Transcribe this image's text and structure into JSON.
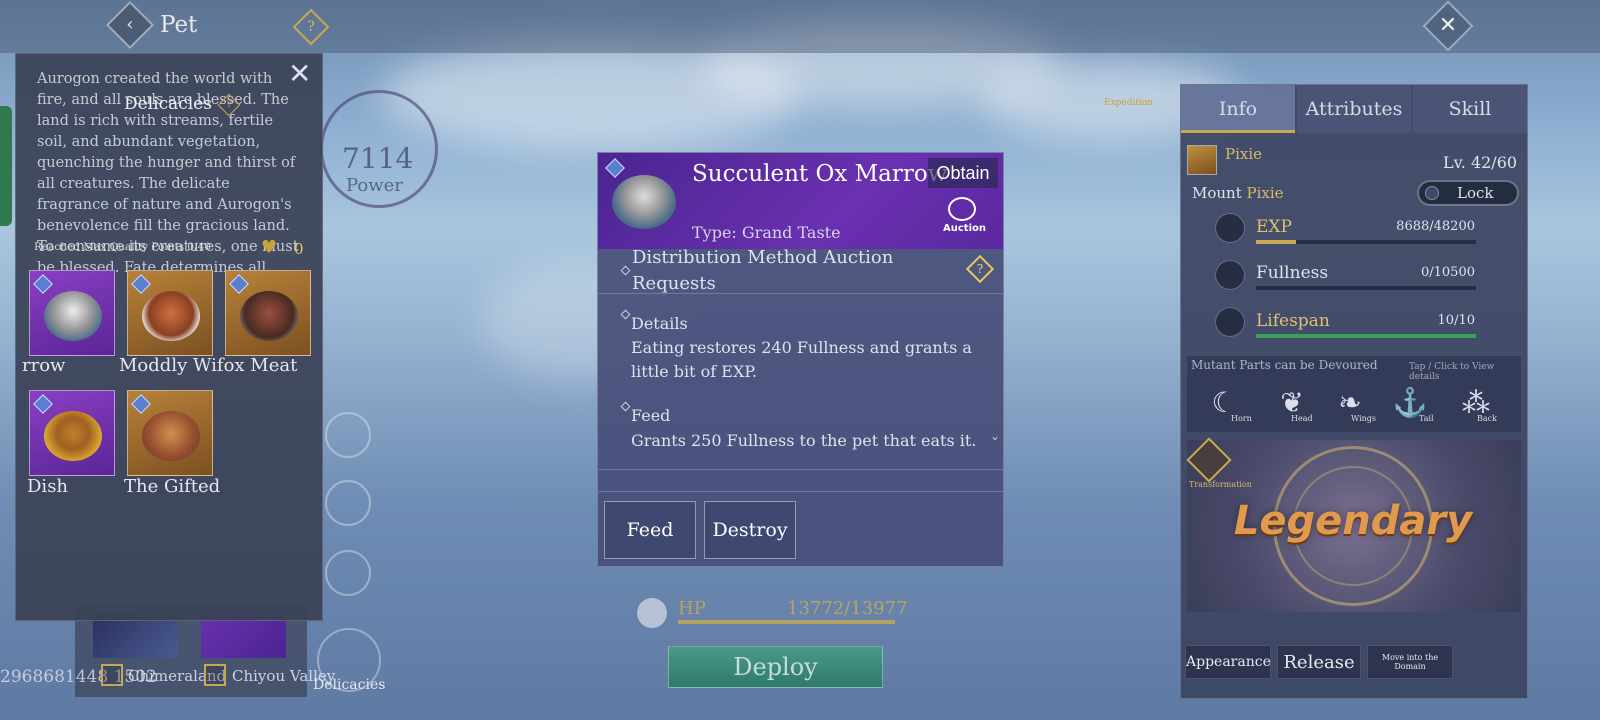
{
  "header": {
    "back_icon": "‹",
    "title": "Pet",
    "help_icon": "?",
    "close_icon": "✕"
  },
  "delicacies_panel": {
    "lore": "Aurogon created the world with fire, and all souls are blessed. The land is rich with streams, fertile soil, and abundant vegetation, quenching the hunger and thirst of all creatures. The delicate fragrance of nature and Aurogon's benevolence fill the gracious land. To consume its creatures, one must be blessed. Fate determines all.",
    "title": "Delicacies",
    "help_icon": "?",
    "close_icon": "✕",
    "quality_text": "Reached Max Quality Points 0/40",
    "heart_icon": "♥",
    "heart_count": "0",
    "items": [
      {
        "name": "rrow",
        "rarity": "purple"
      },
      {
        "name": "Moddly Wifox Meat",
        "rarity": "gold"
      },
      {
        "name": "",
        "rarity": "gold"
      },
      {
        "name": "Dish",
        "rarity": "purple"
      },
      {
        "name": "The Gifted",
        "rarity": "gold"
      }
    ]
  },
  "background": {
    "power_value": "7114",
    "power_label": "Power",
    "coords": "2968681448 1502",
    "locations": [
      "Chimeraland",
      "Chiyou Valley"
    ],
    "delicacies_label": "Delicacies",
    "expedition_label": "Expedition"
  },
  "item_popup": {
    "name": "Succulent Ox Marrow",
    "obtain_label": "Obtain",
    "type_text": "Type: Grand Taste",
    "auction_label": "Auction",
    "distribution_text": "Distribution Method    Auction Requests",
    "help_icon": "?",
    "details_head": "Details",
    "details_body": "Eating restores 240 Fullness and grants a little bit of EXP.",
    "feed_head": "Feed",
    "feed_body": "Grants 250 Fullness to the pet that eats it.",
    "scroll_icon": "⌄",
    "feed_button": "Feed",
    "destroy_button": "Destroy"
  },
  "status": {
    "hp_label": "HP",
    "hp_value": "13772/13977",
    "hp_fraction": 0.985,
    "deploy_button": "Deploy"
  },
  "info_panel": {
    "tabs": [
      "Info",
      "Attributes",
      "Skill"
    ],
    "active_tab": "Info",
    "pet_name": "Pixie",
    "level": "Lv. 42/60",
    "mount_label": "Mount",
    "mount_name": "Pixie",
    "lock_label": "Lock",
    "stats": [
      {
        "name": "EXP",
        "value": "8688/48200",
        "fraction": 0.18,
        "color": "#c8a850"
      },
      {
        "name": "Fullness",
        "value": "0/10500",
        "fraction": 0,
        "color": "#c8a850"
      },
      {
        "name": "Lifespan",
        "value": "10/10",
        "fraction": 1,
        "color": "#3aa05a"
      }
    ],
    "mutant_title": "Mutant Parts can be Devoured",
    "mutant_hint": "Tap / Click to View details",
    "parts": [
      {
        "icon": "☾",
        "label": "Horn"
      },
      {
        "icon": "❦",
        "label": "Head"
      },
      {
        "icon": "❧",
        "label": "Wings"
      },
      {
        "icon": "⚓",
        "label": "Tail"
      },
      {
        "icon": "⁂",
        "label": "Back"
      }
    ],
    "rarity_text": "Legendary",
    "transformation_label": "Transformation",
    "buttons": {
      "appearance": "Appearance",
      "release": "Release",
      "move": "Move into the Domain"
    }
  }
}
